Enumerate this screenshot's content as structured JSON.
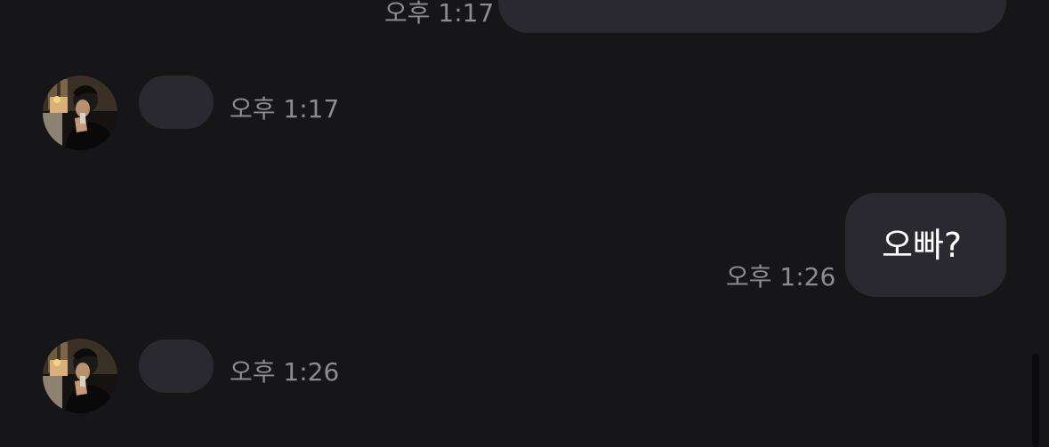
{
  "conversation": {
    "top_outgoing": {
      "time": "오후 1:17"
    },
    "incoming_1": {
      "time": "오후 1:17"
    },
    "outgoing_1": {
      "text": "오빠?",
      "time": "오후 1:26"
    },
    "incoming_2": {
      "time": "오후 1:26"
    }
  }
}
